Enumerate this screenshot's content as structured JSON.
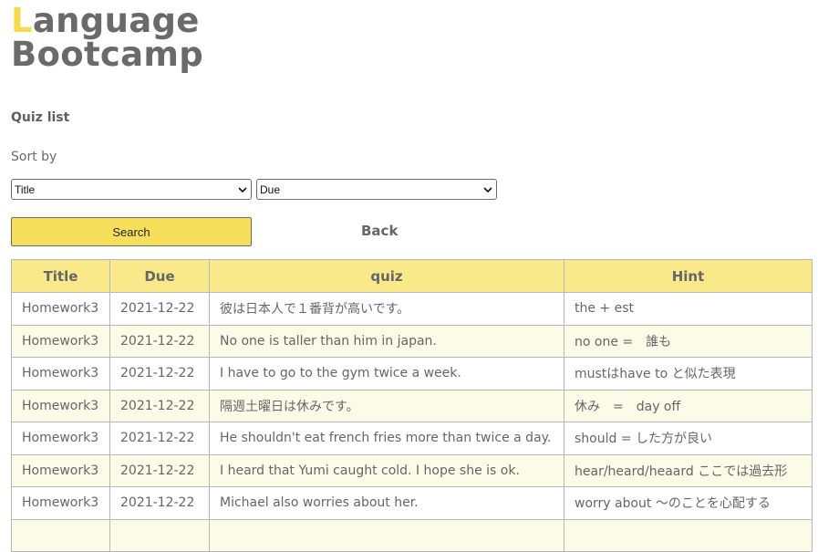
{
  "logo": {
    "accent_letter": "L",
    "rest_line1": "anguage",
    "line2": "Bootcamp"
  },
  "page_title": "Quiz list",
  "sort": {
    "label": "Sort by",
    "select1_value": "Title",
    "select2_value": "Due"
  },
  "search_label": "Search",
  "back_label": "Back",
  "table": {
    "headers": [
      "Title",
      "Due",
      "quiz",
      "Hint"
    ],
    "rows": [
      {
        "title": "Homework3",
        "due": "2021-12-22",
        "quiz": "彼は日本人で１番背が高いです。",
        "hint": "the + est"
      },
      {
        "title": "Homework3",
        "due": "2021-12-22",
        "quiz": "No one is taller than him in japan.",
        "hint": "no one =　誰も"
      },
      {
        "title": "Homework3",
        "due": "2021-12-22",
        "quiz": "I have to go to the gym twice a week.",
        "hint": "mustはhave to と似た表現"
      },
      {
        "title": "Homework3",
        "due": "2021-12-22",
        "quiz": "隔週土曜日は休みです。",
        "hint": "休み　=　day off"
      },
      {
        "title": "Homework3",
        "due": "2021-12-22",
        "quiz": "He shouldn't eat french fries more than twice a day.",
        "hint": "should = した方が良い"
      },
      {
        "title": "Homework3",
        "due": "2021-12-22",
        "quiz": "I heard that Yumi caught cold. I hope she is ok.",
        "hint": "hear/heard/heaard ここでは過去形"
      },
      {
        "title": "Homework3",
        "due": "2021-12-22",
        "quiz": "Michael also worries about her.",
        "hint": "worry about ～のことを心配する"
      },
      {
        "title": "",
        "due": "",
        "quiz": "",
        "hint": ""
      }
    ]
  },
  "colors": {
    "accent": "#f5d94e",
    "button": "#f7df5c",
    "header_bg": "#f9e98a",
    "alt_row": "#fcfbe8"
  }
}
